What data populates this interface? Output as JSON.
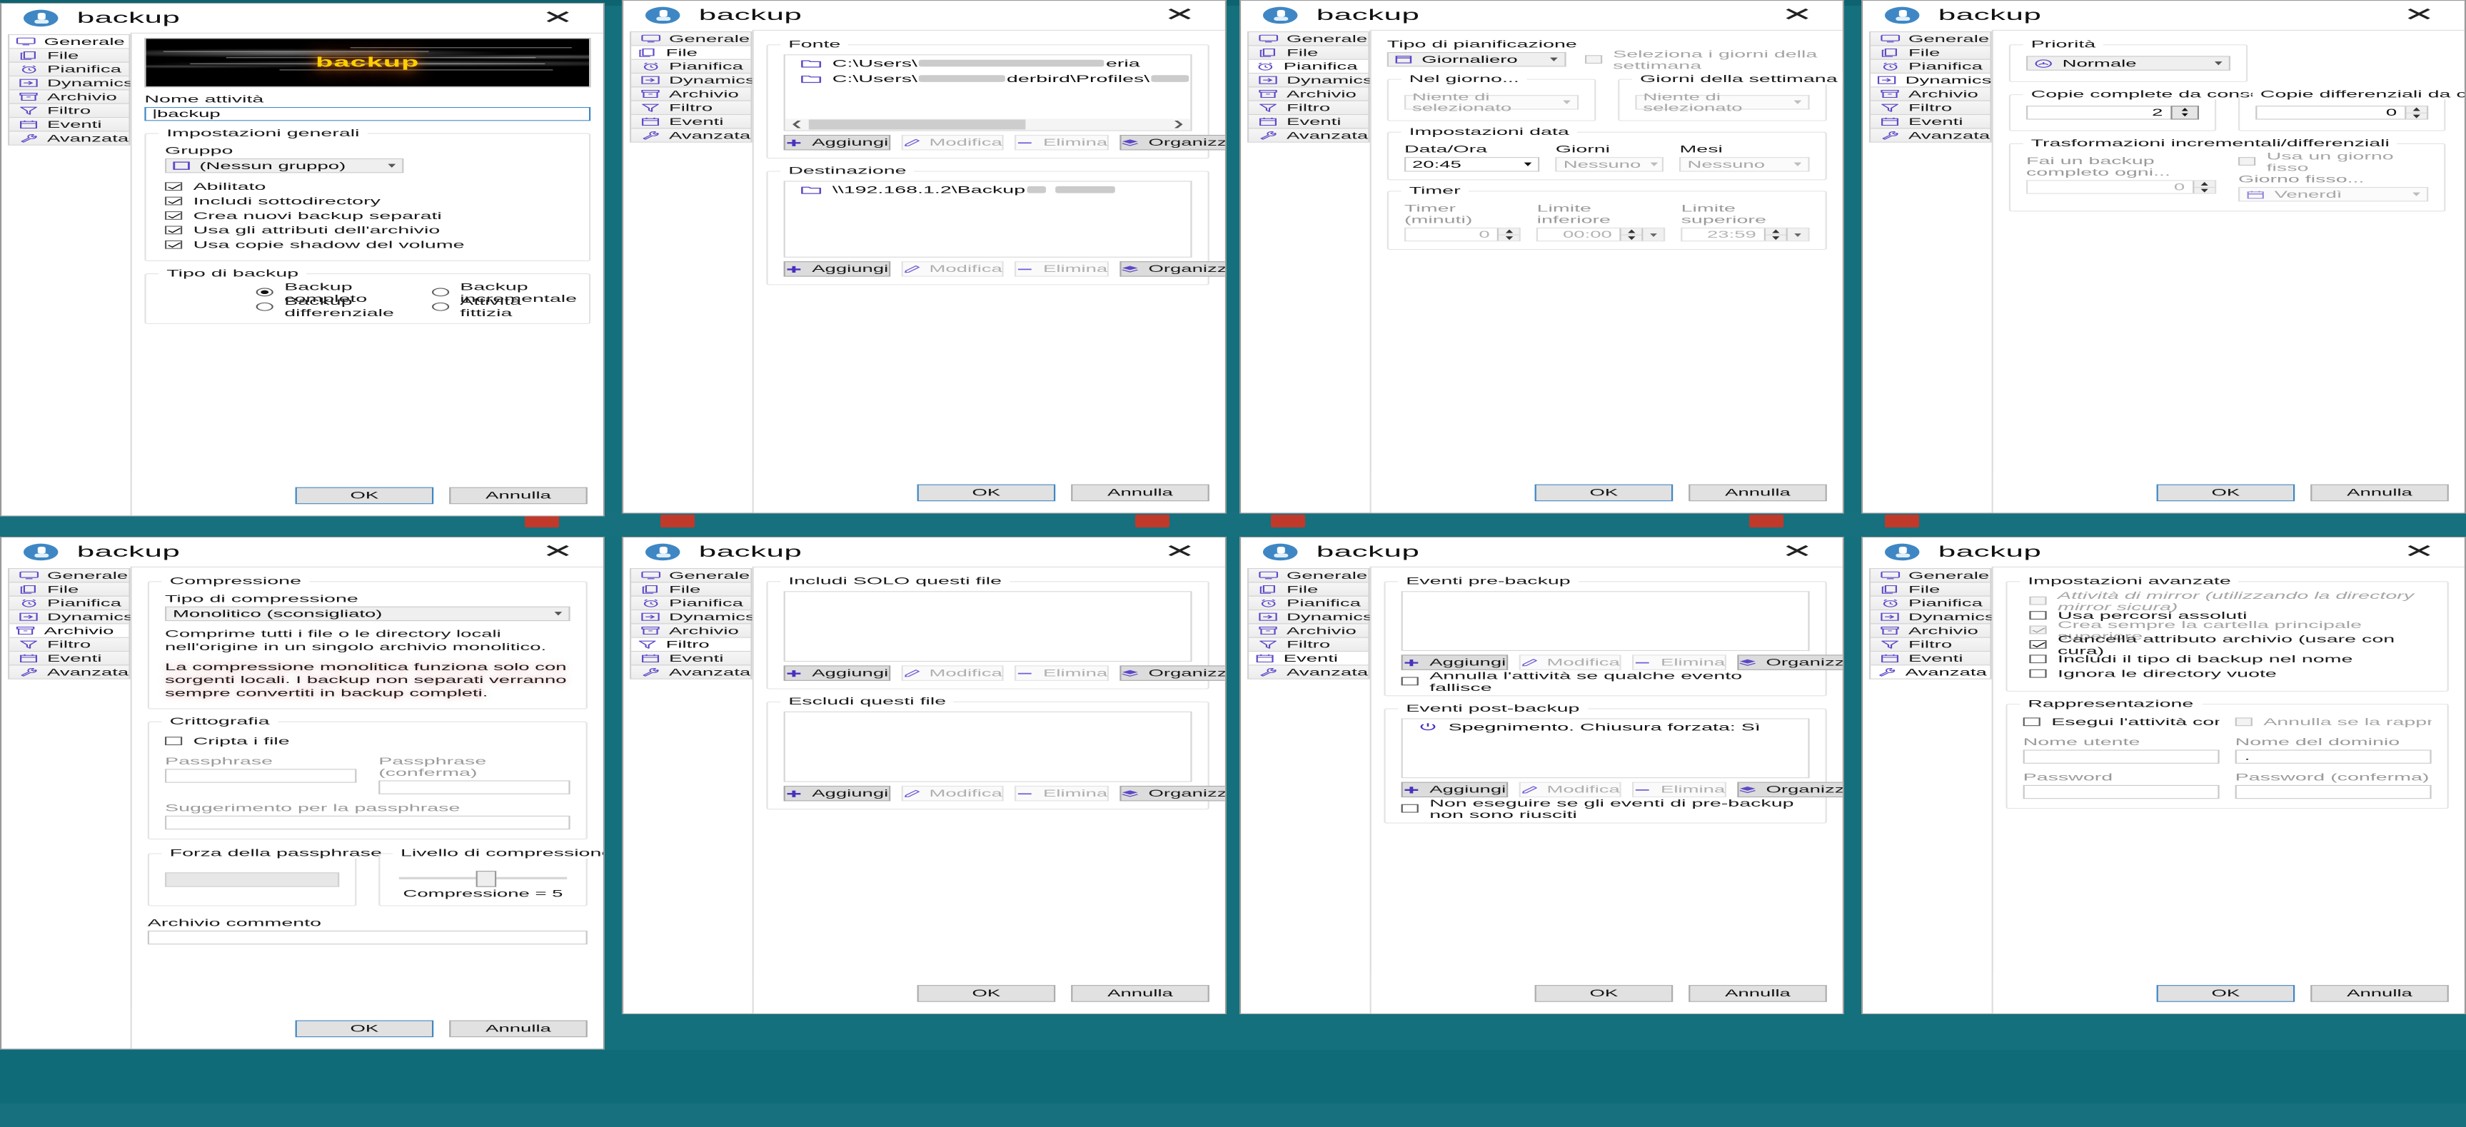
{
  "app": {
    "title": "backup",
    "close_icon": "close-icon",
    "app_icon": "backup-app-icon"
  },
  "tabs": [
    {
      "label": "Generale",
      "icon": "monitor-icon"
    },
    {
      "label": "File",
      "icon": "files-icon"
    },
    {
      "label": "Pianifica",
      "icon": "alarm-clock-icon"
    },
    {
      "label": "Dynamics",
      "icon": "dynamics-icon"
    },
    {
      "label": "Archivio",
      "icon": "archive-box-icon"
    },
    {
      "label": "Filtro",
      "icon": "funnel-icon"
    },
    {
      "label": "Eventi",
      "icon": "calendar-icon"
    },
    {
      "label": "Avanzata",
      "icon": "wrench-icon"
    }
  ],
  "footer": {
    "ok": "OK",
    "cancel": "Annulla"
  },
  "list_buttons": {
    "add": "Aggiungi",
    "edit": "Modifica",
    "delete": "Elimina",
    "organize": "Organizza"
  },
  "dialogs": {
    "generale": {
      "active_tab": "Generale",
      "banner_text": "backup",
      "name_label": "Nome attività",
      "name_value": "backup",
      "general_group": "Impostazioni generali",
      "group_label": "Gruppo",
      "group_value": "(Nessun gruppo)",
      "checks": [
        {
          "label": "Abilitato",
          "checked": true
        },
        {
          "label": "Includi sottodirectory",
          "checked": true
        },
        {
          "label": "Crea nuovi backup separati",
          "checked": true
        },
        {
          "label": "Usa gli attributi dell'archivio",
          "checked": true
        },
        {
          "label": "Usa copie shadow del volume",
          "checked": true
        }
      ],
      "type_group": "Tipo di backup",
      "types": [
        {
          "label": "Backup completo",
          "selected": true
        },
        {
          "label": "Backup incrementale",
          "selected": false
        },
        {
          "label": "Backup differenziale",
          "selected": false
        },
        {
          "label": "Attività fittizia",
          "selected": false
        }
      ]
    },
    "file": {
      "active_tab": "File",
      "source_group": "Fonte",
      "source_items": [
        {
          "prefix": "C:\\Users\\",
          "suffix": "eria",
          "redacted": true
        },
        {
          "prefix": "C:\\Users\\",
          "mid": "derbird\\Profiles\\",
          "redacted": true
        }
      ],
      "dest_group": "Destinazione",
      "dest_items": [
        {
          "prefix": "\\\\192.168.1.2\\Backup ",
          "redacted": true
        }
      ]
    },
    "pianifica": {
      "active_tab": "Pianifica",
      "sched_type_label": "Tipo di pianificazione",
      "sched_type_value": "Giornaliero",
      "select_weekdays_label": "Seleziona i giorni della settimana",
      "select_weekdays_checked": false,
      "on_day_group": "Nel giorno...",
      "on_day_value": "Niente di selezionato",
      "weekdays_group": "Giorni della settimana",
      "weekdays_value": "Niente di selezionato",
      "date_group": "Impostazioni data",
      "datetime_label": "Data/Ora",
      "datetime_value": "20:45",
      "days_label": "Giorni",
      "days_value": "Nessuno",
      "months_label": "Mesi",
      "months_value": "Nessuno",
      "timer_group": "Timer",
      "timer_label": "Timer (minuti)",
      "timer_value": "0",
      "lower_label": "Limite inferiore",
      "lower_value": "00:00",
      "upper_label": "Limite superiore",
      "upper_value": "23:59"
    },
    "dynamics": {
      "active_tab": "Dynamics",
      "priority_group": "Priorità",
      "priority_value": "Normale",
      "full_copies_group": "Copie complete da conservare",
      "full_copies_value": "2",
      "diff_copies_group": "Copie differenziali da conservare",
      "diff_copies_value": "0",
      "transform_group": "Trasformazioni incrementali/differenziali",
      "full_every_label": "Fai un backup completo ogni...",
      "full_every_value": "0",
      "fixed_day_check_label": "Usa un giorno fisso",
      "fixed_day_checked": false,
      "fixed_day_label": "Giorno fisso...",
      "fixed_day_value": "Venerdì"
    },
    "archivio": {
      "active_tab": "Archivio",
      "compression_group": "Compressione",
      "compression_type_label": "Tipo di compressione",
      "compression_type_value": "Monolitico (sconsigliato)",
      "help_1": "Comprime tutti i file o le directory locali nell'origine in un singolo archivio monolitico.",
      "help_2": "La compressione monolitica funziona solo con sorgenti locali. I backup non separati verranno sempre convertiti in backup completi.",
      "crypto_group": "Crittografia",
      "encrypt_label": "Cripta i file",
      "encrypt_checked": false,
      "passphrase_label": "Passphrase",
      "passphrase_confirm_label": "Passphrase (conferma)",
      "hint_label": "Suggerimento per la passphrase",
      "strength_group": "Forza della passphrase",
      "level_group": "Livello di compressione",
      "level_caption": "Compressione = 5",
      "comment_label": "Archivio commento"
    },
    "filtro": {
      "active_tab": "Filtro",
      "include_group": "Includi SOLO questi file",
      "exclude_group": "Escludi questi file"
    },
    "eventi": {
      "active_tab": "Eventi",
      "pre_group": "Eventi pre-backup",
      "pre_check_label": "Annulla l'attività se qualche evento fallisce",
      "pre_checked": false,
      "post_group": "Eventi post-backup",
      "post_items": [
        "Spegnimento. Chiusura forzata: Sì"
      ],
      "post_check_label": "Non eseguire se gli eventi di pre-backup non sono riusciti",
      "post_checked": false
    },
    "avanzata": {
      "active_tab": "Avanzata",
      "advanced_group": "Impostazioni avanzate",
      "checks": [
        {
          "label": "Attività di mirror (utilizzando la directory mirror sicura)",
          "checked": false,
          "disabled": true,
          "italic": true
        },
        {
          "label": "Usa percorsi assoluti",
          "checked": false,
          "disabled": false
        },
        {
          "label": "Crea sempre la cartella principale superiore",
          "checked": true,
          "disabled": true
        },
        {
          "label": "Cancella attributo archivio (usare con cura)",
          "checked": true,
          "disabled": false
        },
        {
          "label": "Includi il tipo di backup nel nome",
          "checked": false,
          "disabled": false
        },
        {
          "label": "Ignora le directory vuote",
          "checked": false,
          "disabled": false
        }
      ],
      "impersonation_group": "Rappresentazione",
      "run_as_label": "Esegui l'attività come un altro utent",
      "run_as_checked": false,
      "fail_label": "Annulla se la rappresentazione falli",
      "fail_checked": false,
      "username_label": "Nome utente",
      "username_value": "",
      "domain_label": "Nome del dominio",
      "domain_value": ".",
      "password_label": "Password",
      "password_confirm_label": "Password (conferma)"
    }
  },
  "colors": {
    "accent": "#3f87c4",
    "icon": "#5b49c7",
    "desktop": "#13707c",
    "banner_text": "#ffd000"
  }
}
